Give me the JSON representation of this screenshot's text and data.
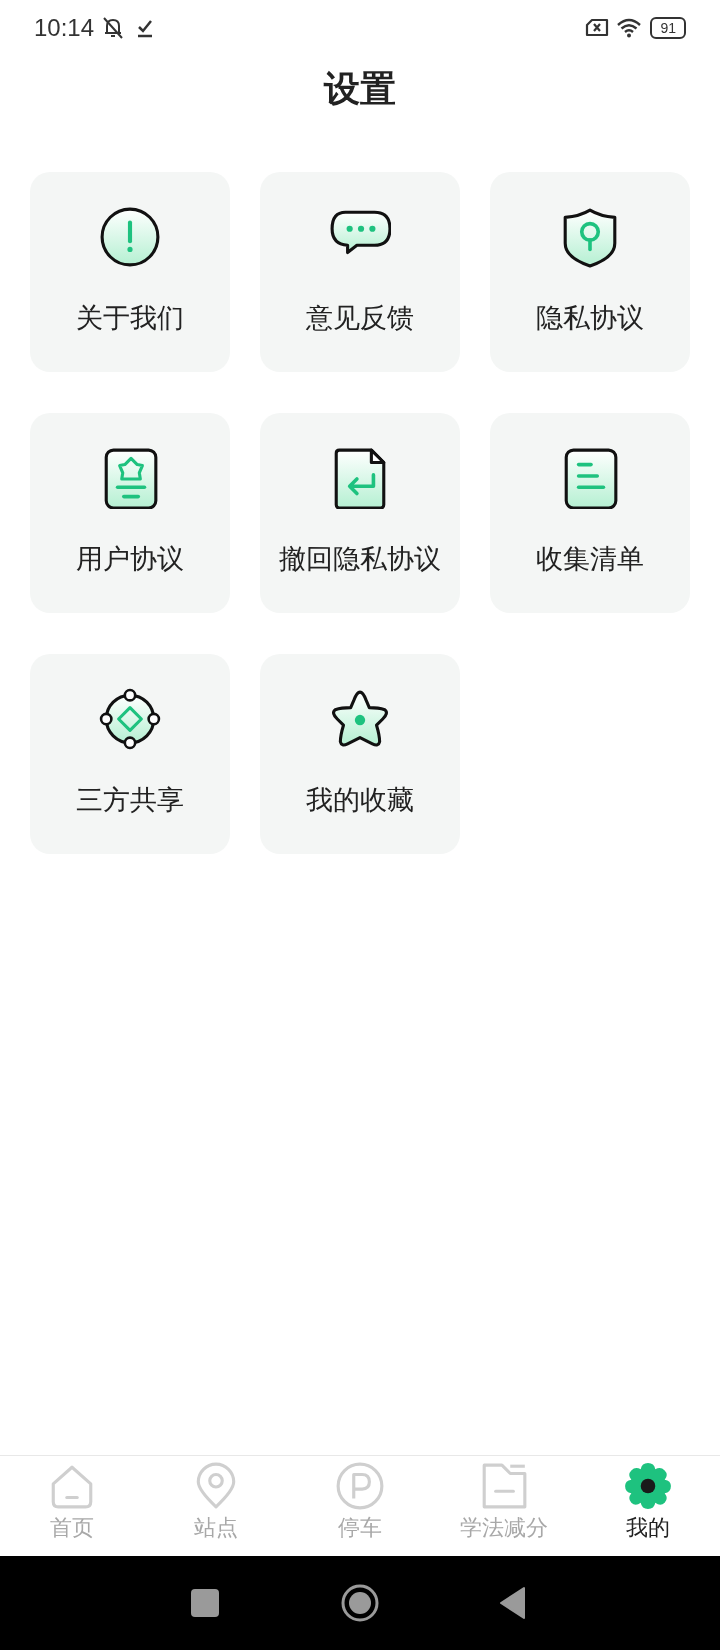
{
  "status_bar": {
    "time": "10:14",
    "battery": "91"
  },
  "title": "设置",
  "items": [
    {
      "label": "关于我们",
      "kind": "info"
    },
    {
      "label": "意见反馈",
      "kind": "chat"
    },
    {
      "label": "隐私协议",
      "kind": "shield"
    },
    {
      "label": "用户协议",
      "kind": "badge"
    },
    {
      "label": "撤回隐私协议",
      "kind": "return"
    },
    {
      "label": "收集清单",
      "kind": "list"
    },
    {
      "label": "三方共享",
      "kind": "share"
    },
    {
      "label": "我的收藏",
      "kind": "star"
    }
  ],
  "tab_bar": [
    {
      "label": "首页",
      "kind": "home",
      "selected": false
    },
    {
      "label": "站点",
      "kind": "pin",
      "selected": false
    },
    {
      "label": "停车",
      "kind": "parking",
      "selected": false
    },
    {
      "label": "学法减分",
      "kind": "folder",
      "selected": false
    },
    {
      "label": "我的",
      "kind": "gear",
      "selected": true
    }
  ]
}
